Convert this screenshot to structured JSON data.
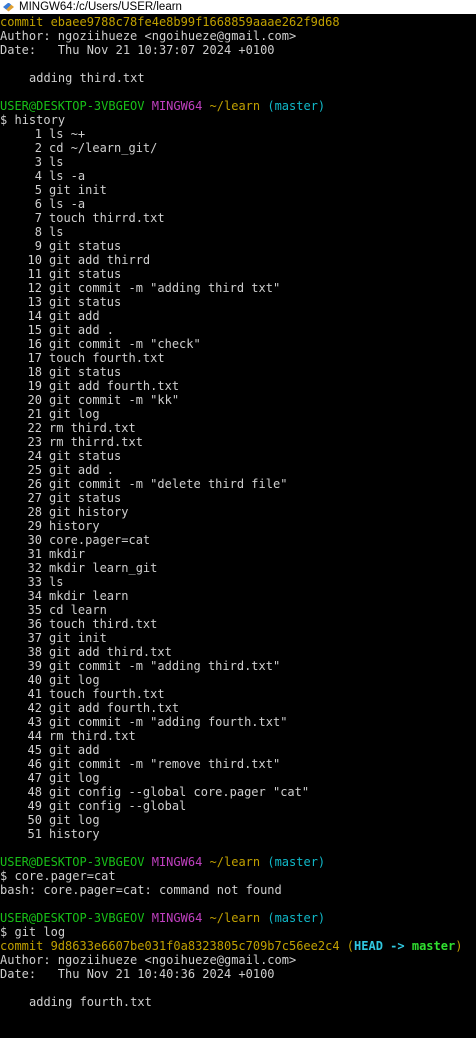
{
  "window": {
    "title": "MINGW64:/c/Users/USER/learn",
    "icon": "git-bash-icon"
  },
  "terminal": {
    "commit1": {
      "commit_label": "commit ebaee9788c78fe4e8b99f1668859aaae262f9d68",
      "author": "Author: ngoziihueze <ngoihueze@gmail.com>",
      "date": "Date:   Thu Nov 21 10:37:07 2024 +0100",
      "message": "adding third.txt"
    },
    "prompt": {
      "user_host": "USER@DESKTOP-3VBGEOV",
      "shell": "MINGW64",
      "path": "~/learn",
      "branch": "(master)",
      "symbol": "$"
    },
    "cmd_history": "history",
    "history": [
      {
        "n": "1",
        "cmd": "ls ~+"
      },
      {
        "n": "2",
        "cmd": "cd ~/learn_git/"
      },
      {
        "n": "3",
        "cmd": "ls"
      },
      {
        "n": "4",
        "cmd": "ls -a"
      },
      {
        "n": "5",
        "cmd": "git init"
      },
      {
        "n": "6",
        "cmd": "ls -a"
      },
      {
        "n": "7",
        "cmd": "touch thirrd.txt"
      },
      {
        "n": "8",
        "cmd": "ls"
      },
      {
        "n": "9",
        "cmd": "git status"
      },
      {
        "n": "10",
        "cmd": "git add thirrd"
      },
      {
        "n": "11",
        "cmd": "git status"
      },
      {
        "n": "12",
        "cmd": "git commit -m \"adding third txt\""
      },
      {
        "n": "13",
        "cmd": "git status"
      },
      {
        "n": "14",
        "cmd": "git add"
      },
      {
        "n": "15",
        "cmd": "git add ."
      },
      {
        "n": "16",
        "cmd": "git commit -m \"check\""
      },
      {
        "n": "17",
        "cmd": "touch fourth.txt"
      },
      {
        "n": "18",
        "cmd": "git status"
      },
      {
        "n": "19",
        "cmd": "git add fourth.txt"
      },
      {
        "n": "20",
        "cmd": "git commit -m \"kk\""
      },
      {
        "n": "21",
        "cmd": "git log"
      },
      {
        "n": "22",
        "cmd": "rm third.txt"
      },
      {
        "n": "23",
        "cmd": "rm thirrd.txt"
      },
      {
        "n": "24",
        "cmd": "git status"
      },
      {
        "n": "25",
        "cmd": "git add ."
      },
      {
        "n": "26",
        "cmd": "git commit -m \"delete third file\""
      },
      {
        "n": "27",
        "cmd": "git status"
      },
      {
        "n": "28",
        "cmd": "git history"
      },
      {
        "n": "29",
        "cmd": "history"
      },
      {
        "n": "30",
        "cmd": "core.pager=cat"
      },
      {
        "n": "31",
        "cmd": "mkdir"
      },
      {
        "n": "32",
        "cmd": "mkdir learn_git"
      },
      {
        "n": "33",
        "cmd": "ls"
      },
      {
        "n": "34",
        "cmd": "mkdir learn"
      },
      {
        "n": "35",
        "cmd": "cd learn"
      },
      {
        "n": "36",
        "cmd": "touch third.txt"
      },
      {
        "n": "37",
        "cmd": "git init"
      },
      {
        "n": "38",
        "cmd": "git add third.txt"
      },
      {
        "n": "39",
        "cmd": "git commit -m \"adding third.txt\""
      },
      {
        "n": "40",
        "cmd": "git log"
      },
      {
        "n": "41",
        "cmd": "touch fourth.txt"
      },
      {
        "n": "42",
        "cmd": "git add fourth.txt"
      },
      {
        "n": "43",
        "cmd": "git commit -m \"adding fourth.txt\""
      },
      {
        "n": "44",
        "cmd": "rm third.txt"
      },
      {
        "n": "45",
        "cmd": "git add"
      },
      {
        "n": "46",
        "cmd": "git commit -m \"remove third.txt\""
      },
      {
        "n": "47",
        "cmd": "git log"
      },
      {
        "n": "48",
        "cmd": "git config --global core.pager \"cat\""
      },
      {
        "n": "49",
        "cmd": "git config --global"
      },
      {
        "n": "50",
        "cmd": "git log"
      },
      {
        "n": "51",
        "cmd": "history"
      }
    ],
    "cmd_pager": "core.pager=cat",
    "error_output": "bash: core.pager=cat: command not found",
    "cmd_gitlog": "git log",
    "commit2": {
      "commit_label": "commit 9d8633e6607be031f0a8323805c709b7c56ee2c4",
      "head_open": "(",
      "head": "HEAD",
      "arrow": "->",
      "branch": "master",
      "head_close": ")",
      "author": "Author: ngoziihueze <ngoihueze@gmail.com>",
      "date": "Date:   Thu Nov 21 10:40:36 2024 +0100",
      "message": "adding fourth.txt"
    }
  },
  "colors": {
    "background": "#000000",
    "text": "#cfcfcf",
    "commit": "#c0a000",
    "user_host": "#18c018",
    "shell": "#c040c0",
    "path": "#c0a000",
    "branch": "#10b8c8"
  }
}
